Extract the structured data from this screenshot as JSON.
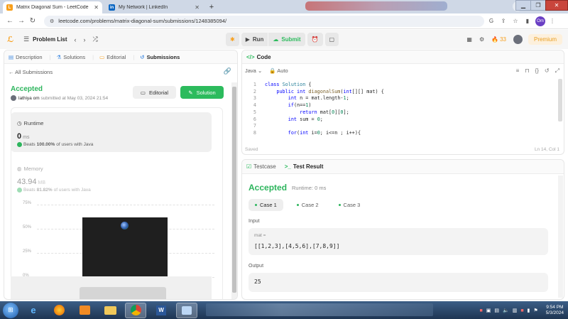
{
  "browser": {
    "tabs": [
      {
        "title": "Matrix Diagonal Sum - LeetCode",
        "favicon": "leetcode-icon",
        "active": true
      },
      {
        "title": "My Network | LinkedIn",
        "favicon": "linkedin-icon",
        "active": false
      }
    ],
    "url": "leetcode.com/problems/matrix-diagonal-sum/submissions/1248385094/",
    "profile_initials": "Om"
  },
  "lc_nav": {
    "problem_list": "Problem List",
    "run": "Run",
    "submit": "Submit",
    "streak": "33",
    "premium": "Premium"
  },
  "left": {
    "tabs": [
      "Description",
      "Solutions",
      "Editorial",
      "Submissions"
    ],
    "all_submissions": "All Submissions",
    "status": "Accepted",
    "user": "lathiya om",
    "submitted_at": "submitted at May 03, 2024 21:54",
    "editorial_btn": "Editorial",
    "solution_btn": "Solution",
    "runtime": {
      "label": "Runtime",
      "value": "0",
      "unit": "ms",
      "beats_pre": "Beats",
      "beats_pct": "100.00%",
      "beats_post": "of users with Java"
    },
    "memory": {
      "label": "Memory",
      "value": "43.94",
      "unit": "MB",
      "beats_pre": "Beats",
      "beats_pct": "81.82%",
      "beats_post": "of users with Java"
    },
    "chart_ticks": [
      "75%",
      "50%",
      "25%",
      "0%"
    ]
  },
  "code": {
    "header": "Code",
    "language": "Java",
    "mode": "Auto",
    "saved": "Saved",
    "cursor": "Ln 14, Col 1",
    "lines": [
      {
        "n": "1",
        "t": [
          [
            "kw",
            "class "
          ],
          [
            "ty",
            "Solution "
          ],
          [
            "pl",
            "{"
          ]
        ]
      },
      {
        "n": "2",
        "t": [
          [
            "pl",
            "    "
          ],
          [
            "kw",
            "public int "
          ],
          [
            "fn",
            "diagonalSum"
          ],
          [
            "pl",
            "("
          ],
          [
            "kw",
            "int"
          ],
          [
            "pl",
            "[][] mat) {"
          ]
        ]
      },
      {
        "n": "3",
        "t": [
          [
            "pl",
            "        "
          ],
          [
            "kw",
            "int "
          ],
          [
            "pl",
            "n = mat.length-"
          ],
          [
            "num",
            "1"
          ],
          [
            "pl",
            ";"
          ]
        ]
      },
      {
        "n": "4",
        "t": [
          [
            "pl",
            "        "
          ],
          [
            "kw",
            "if"
          ],
          [
            "pl",
            "(n=="
          ],
          [
            "num",
            "1"
          ],
          [
            "pl",
            ")"
          ]
        ]
      },
      {
        "n": "5",
        "t": [
          [
            "pl",
            "            "
          ],
          [
            "kw",
            "return "
          ],
          [
            "pl",
            "mat["
          ],
          [
            "num",
            "0"
          ],
          [
            "pl",
            "]["
          ],
          [
            "num",
            "0"
          ],
          [
            "pl",
            "];"
          ]
        ]
      },
      {
        "n": "6",
        "t": [
          [
            "pl",
            "        "
          ],
          [
            "kw",
            "int "
          ],
          [
            "pl",
            "sum = "
          ],
          [
            "num",
            "0"
          ],
          [
            "pl",
            ";"
          ]
        ]
      },
      {
        "n": "7",
        "t": [
          [
            "pl",
            ""
          ]
        ]
      },
      {
        "n": "8",
        "t": [
          [
            "pl",
            "        "
          ],
          [
            "kw",
            "for"
          ],
          [
            "pl",
            "("
          ],
          [
            "kw",
            "int "
          ],
          [
            "pl",
            "i="
          ],
          [
            "num",
            "0"
          ],
          [
            "pl",
            "; i<=n ; i++){"
          ]
        ]
      }
    ]
  },
  "result": {
    "tab_testcase": "Testcase",
    "tab_result": "Test Result",
    "status": "Accepted",
    "runtime": "Runtime: 0 ms",
    "cases": [
      "Case 1",
      "Case 2",
      "Case 3"
    ],
    "input_label": "Input",
    "input_var": "mat =",
    "input_value": "[[1,2,3],[4,5,6],[7,8,9]]",
    "output_label": "Output",
    "output_value": "25"
  },
  "taskbar": {
    "time": "9:54 PM",
    "date": "5/3/2024"
  },
  "colors": {
    "accent_green": "#2cbb5d",
    "leetcode_orange": "#f89f1b",
    "keyword_blue": "#0000ff"
  }
}
